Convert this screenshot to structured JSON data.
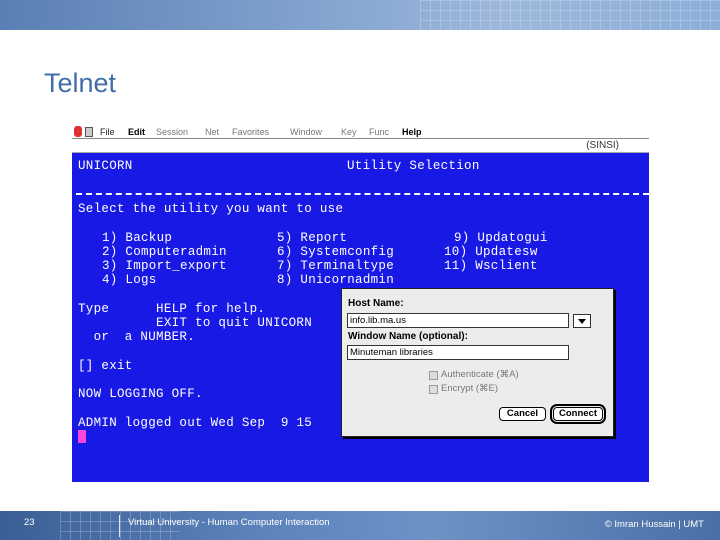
{
  "slide": {
    "title": "Telnet",
    "page_number": "23",
    "footer_course": "Virtual University - Human Computer Interaction",
    "footer_copyright": "© Imran Hussain | UMT"
  },
  "menubar": {
    "items": [
      "File",
      "Edit",
      "Session",
      "Net",
      "Favorites",
      "Window",
      "Key",
      "Func",
      "Help"
    ]
  },
  "session": {
    "label": "(SINSI)"
  },
  "terminal": {
    "app_name": "UNICORN",
    "screen_title": "Utility Selection",
    "prompt": "Select the utility you want to use",
    "options_col1": [
      "1) Backup",
      "2) Computeradmin",
      "3) Import_export",
      "4) Logs"
    ],
    "options_col2": [
      "5) Report",
      "6) Systemconfig",
      "7) Terminaltype",
      "8) Unicornadmin"
    ],
    "options_col3": [
      "9) Updatogui",
      "10) Updatesw",
      "11) Wsclient"
    ],
    "help_line1": "Type      HELP for help.",
    "help_line2": "          EXIT to quit UNICORN",
    "help_line3": "  or  a NUMBER.",
    "input_line": "[] exit",
    "logging_off": "NOW LOGGING OFF.",
    "logout_msg": "ADMIN logged out Wed Sep  9 15"
  },
  "dialog": {
    "host_label": "Host Name:",
    "host_value": "info.lib.ma.us",
    "window_label": "Window Name (optional):",
    "window_value": "Minuteman libraries",
    "authenticate_label": "Authenticate (⌘A)",
    "encrypt_label": "Encrypt (⌘E)",
    "cancel_label": "Cancel",
    "connect_label": "Connect"
  }
}
